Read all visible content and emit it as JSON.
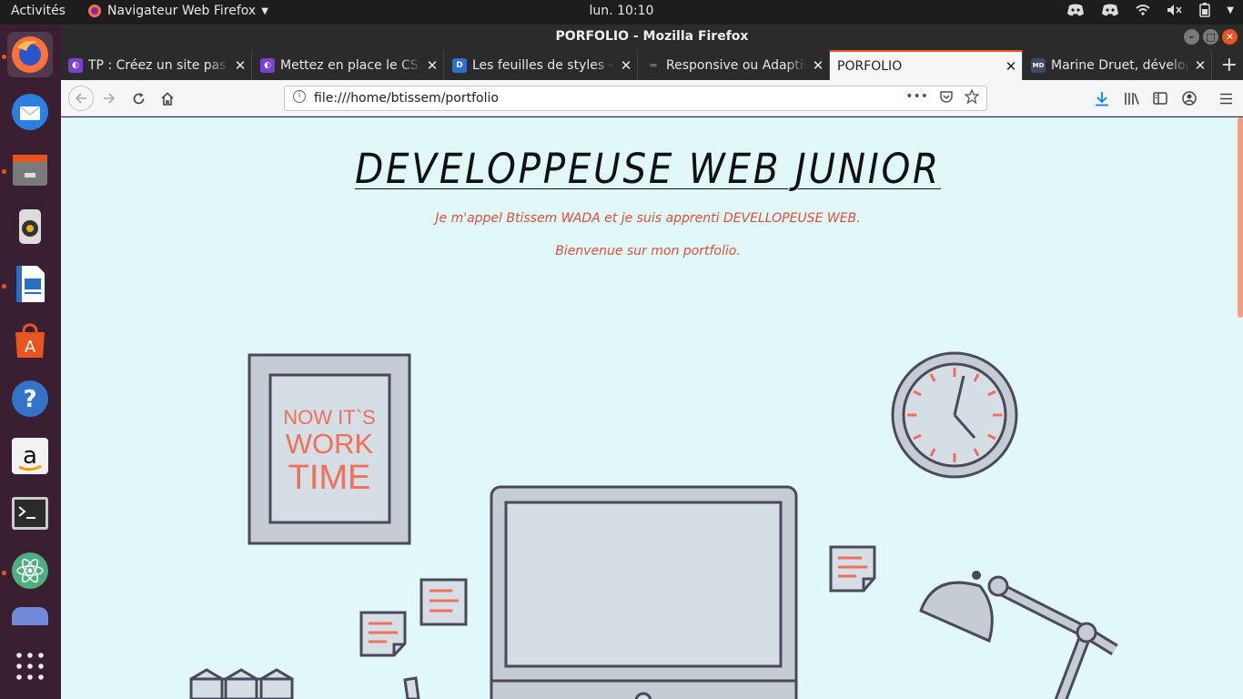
{
  "topbar": {
    "activities": "Activités",
    "app_menu": "Navigateur Web Firefox",
    "clock": "lun. 10:10"
  },
  "window": {
    "title": "PORFOLIO - Mozilla Firefox"
  },
  "tabs": [
    {
      "label": "TP : Créez un site pas à pas",
      "favicon": "openclassrooms-icon",
      "selected": false
    },
    {
      "label": "Mettez en place le CSS",
      "favicon": "openclassrooms-icon",
      "selected": false
    },
    {
      "label": "Les feuilles de styles - CSS",
      "favicon": "d-icon",
      "selected": false
    },
    {
      "label": "Responsive ou Adaptive",
      "favicon": "page-icon",
      "selected": false
    },
    {
      "label": "PORFOLIO",
      "favicon": "",
      "selected": true
    },
    {
      "label": "Marine Druet, développeuse",
      "favicon": "md-icon",
      "selected": false
    }
  ],
  "navbar": {
    "url": "file:///home/btissem/portfolio",
    "more_actions": "•••"
  },
  "page": {
    "heading": "DEVELOPPEUSE WEB JUNIOR",
    "intro_line1": "Je m'appel Btissem WADA et je suis apprenti DEVELLOPEUSE WEB.",
    "intro_line2": "Bienvenue sur mon portfolio.",
    "poster_text_1": "NOW IT`S",
    "poster_text_2": "WORK",
    "poster_text_3": "TIME"
  },
  "colors": {
    "accent": "#e95420",
    "illustration_red": "#f0705a",
    "illustration_stroke": "#4a4a5a",
    "page_background": "#e0f8f8"
  }
}
